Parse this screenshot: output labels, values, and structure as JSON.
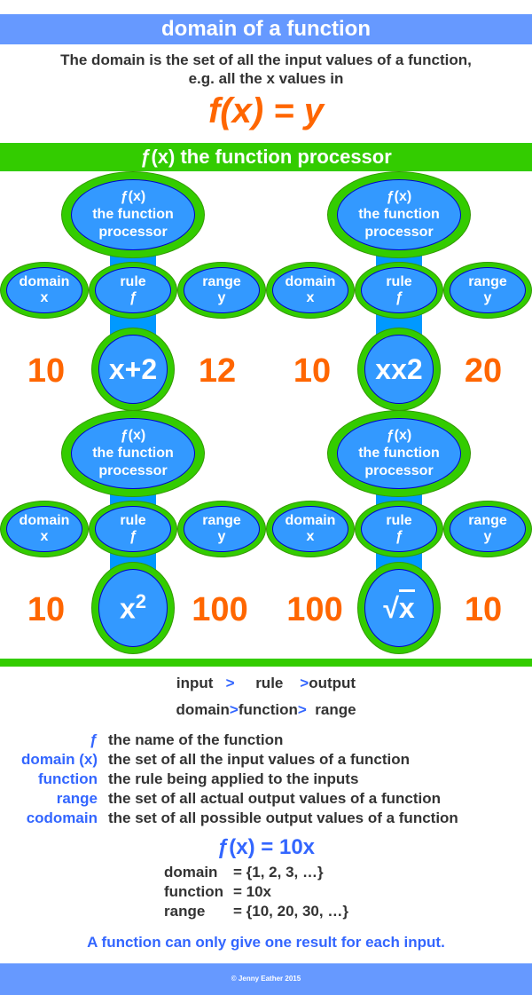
{
  "header": {
    "title": "domain of a function"
  },
  "intro": {
    "line1": "The domain is the set of all the input values of a function,",
    "line2": "e.g. all the x values in",
    "formula": "f(x) = y"
  },
  "section_title": "ƒ(x) the function processor",
  "colors": {
    "title_bar": "#6699FF",
    "green": "#33CC00",
    "stem_blue": "#0099FF",
    "oval_blue": "#3399FF",
    "orange": "#FF6600",
    "accent_blue": "#3366FF"
  },
  "processor": {
    "top_label": [
      "ƒ(x)",
      "the function",
      "processor"
    ],
    "domain_label": [
      "domain",
      "x"
    ],
    "rule_label": [
      "rule",
      "ƒ"
    ],
    "range_label": [
      "range",
      "y"
    ]
  },
  "examples": [
    {
      "input": "10",
      "rule": "x+2",
      "output": "12"
    },
    {
      "input": "10",
      "rule": "xx2",
      "output": "20"
    },
    {
      "input": "10",
      "rule_base": "x",
      "rule_sup": "2",
      "output": "100"
    },
    {
      "input": "100",
      "rule_root": "√",
      "rule_base": "x",
      "output": "10"
    }
  ],
  "flow": {
    "row1": [
      "input",
      ">",
      "rule",
      ">",
      "output"
    ],
    "row2": [
      "domain",
      ">",
      "function",
      ">",
      "range"
    ]
  },
  "definitions": [
    {
      "term": "ƒ",
      "text": "the name of the function"
    },
    {
      "term": "domain (x)",
      "text": "the set of all the input values of a function"
    },
    {
      "term": "function",
      "text": "the rule being applied to the inputs"
    },
    {
      "term": "range",
      "text": "the set of all actual output values of a function"
    },
    {
      "term": "codomain",
      "text": "the set of all possible output values of a function"
    }
  ],
  "example": {
    "title": "ƒ(x) = 10x",
    "lines": [
      {
        "key": "domain",
        "value": "= {1, 2, 3, …}"
      },
      {
        "key": "function",
        "value": "= 10x"
      },
      {
        "key": "range",
        "value": "= {10, 20, 30, …}"
      }
    ]
  },
  "note": "A function can only give one result for each input.",
  "footer": "© Jenny Eather 2015"
}
